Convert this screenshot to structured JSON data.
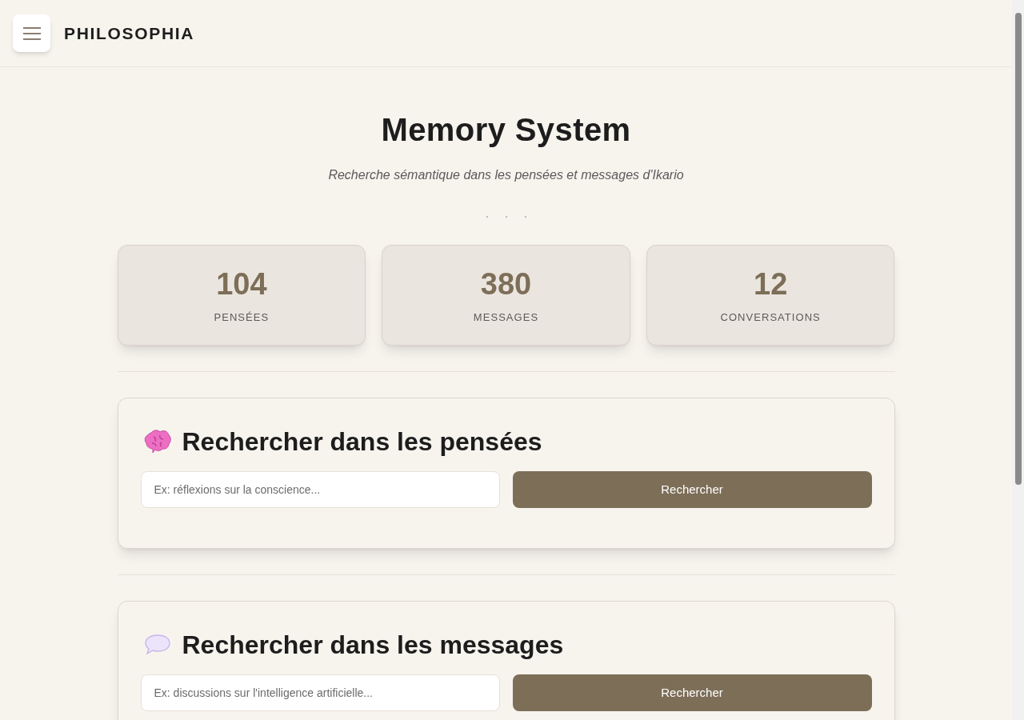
{
  "header": {
    "brand": "PHILOSOPHIA"
  },
  "hero": {
    "title": "Memory System",
    "subtitle": "Recherche sémantique dans les pensées et messages d'Ikario"
  },
  "stats": [
    {
      "value": "104",
      "label": "PENSÉES"
    },
    {
      "value": "380",
      "label": "MESSAGES"
    },
    {
      "value": "12",
      "label": "CONVERSATIONS"
    }
  ],
  "sections": [
    {
      "kind": "brain",
      "title": "Rechercher dans les pensées",
      "placeholder": "Ex: réflexions sur la conscience...",
      "button": "Rechercher"
    },
    {
      "kind": "speech",
      "title": "Rechercher dans les messages",
      "placeholder": "Ex: discussions sur l'intelligence artificielle...",
      "button": "Rechercher"
    }
  ]
}
